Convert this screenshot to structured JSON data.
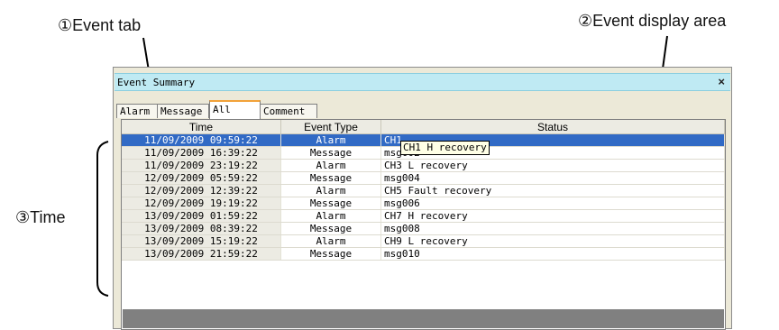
{
  "callouts": {
    "event_tab": "①Event tab",
    "event_display_area": "②Event display area",
    "time": "③Time"
  },
  "window": {
    "title": "Event Summary",
    "close_label": "×"
  },
  "tabs": [
    "Alarm",
    "Message",
    "All",
    "Comment"
  ],
  "active_tab": "All",
  "columns": [
    "Time",
    "Event Type",
    "Status"
  ],
  "rows": [
    {
      "time": "11/09/2009 09:59:22",
      "type": "Alarm",
      "status": "CH1 H recovery"
    },
    {
      "time": "11/09/2009 16:39:22",
      "type": "Message",
      "status": "msg002"
    },
    {
      "time": "11/09/2009 23:19:22",
      "type": "Alarm",
      "status": "CH3 L recovery"
    },
    {
      "time": "12/09/2009 05:59:22",
      "type": "Message",
      "status": "msg004"
    },
    {
      "time": "12/09/2009 12:39:22",
      "type": "Alarm",
      "status": "CH5 Fault recovery"
    },
    {
      "time": "12/09/2009 19:19:22",
      "type": "Message",
      "status": "msg006"
    },
    {
      "time": "13/09/2009 01:59:22",
      "type": "Alarm",
      "status": "CH7 H recovery"
    },
    {
      "time": "13/09/2009 08:39:22",
      "type": "Message",
      "status": "msg008"
    },
    {
      "time": "13/09/2009 15:19:22",
      "type": "Alarm",
      "status": "CH9 L recovery"
    },
    {
      "time": "13/09/2009 21:59:22",
      "type": "Message",
      "status": "msg010"
    }
  ],
  "tooltip": "CH1 H recovery",
  "selected_row_status_visible": "CH1",
  "colors": {
    "title_bar": "#bfeaf3",
    "selection": "#316ac5",
    "active_tab_accent": "#f2a23a"
  }
}
